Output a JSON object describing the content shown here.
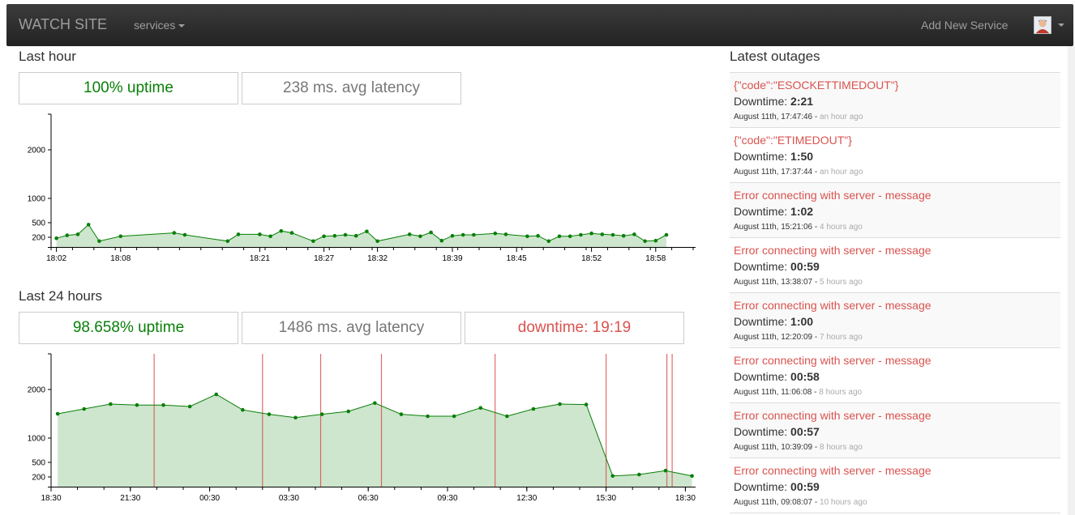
{
  "navbar": {
    "brand": "WATCH SITE",
    "services_label": "services",
    "add_service_label": "Add New Service",
    "avatar_icon": "user-avatar"
  },
  "last_hour": {
    "title": "Last hour",
    "uptime": "100% uptime",
    "latency": "238 ms. avg latency"
  },
  "last_24": {
    "title": "Last 24 hours",
    "uptime": "98.658% uptime",
    "latency": "1486 ms. avg latency",
    "downtime": "downtime: 19:19"
  },
  "colors": {
    "green": "#087f08",
    "red": "#d9534f",
    "area": "#cde6cd"
  },
  "chart_data": [
    {
      "type": "area",
      "name": "last_hour",
      "ylim": [
        0,
        2700
      ],
      "yticks": [
        200,
        500,
        1000,
        2000
      ],
      "xlim": [
        0,
        60
      ],
      "xticks": [
        {
          "x": 0.5,
          "label": "18:02"
        },
        {
          "x": 6.5,
          "label": "18:08"
        },
        {
          "x": 19.5,
          "label": "18:21"
        },
        {
          "x": 25.5,
          "label": "18:27"
        },
        {
          "x": 30.5,
          "label": "18:32"
        },
        {
          "x": 37.5,
          "label": "18:39"
        },
        {
          "x": 43.5,
          "label": "18:45"
        },
        {
          "x": 50.5,
          "label": "18:52"
        },
        {
          "x": 56.5,
          "label": "18:58"
        }
      ],
      "x": [
        0.5,
        1.5,
        2.5,
        3.5,
        4.5,
        6.5,
        11.5,
        12.5,
        16.5,
        17.5,
        19.5,
        20.5,
        21.5,
        22.5,
        24.5,
        25.5,
        26.5,
        27.5,
        28.5,
        29.5,
        30.5,
        33.5,
        34.5,
        35.5,
        36.5,
        37.5,
        38.5,
        39.5,
        41.5,
        42.5,
        44.5,
        45.5,
        46.5,
        47.5,
        48.5,
        49.5,
        50.5,
        51.5,
        52.5,
        53.5,
        54.5,
        55.5,
        56.5,
        57.5
      ],
      "values": [
        180,
        240,
        260,
        460,
        120,
        220,
        290,
        250,
        120,
        260,
        260,
        220,
        330,
        290,
        120,
        220,
        230,
        250,
        230,
        320,
        120,
        260,
        220,
        300,
        130,
        230,
        250,
        250,
        280,
        260,
        220,
        230,
        120,
        220,
        220,
        250,
        280,
        260,
        250,
        230,
        260,
        120,
        130,
        250
      ]
    },
    {
      "type": "area",
      "name": "last_24_hours",
      "ylim": [
        0,
        2700
      ],
      "yticks": [
        200,
        500,
        1000,
        2000
      ],
      "xlim": [
        0,
        24
      ],
      "xticks": [
        {
          "x": 0,
          "label": "18:30"
        },
        {
          "x": 3,
          "label": "21:30"
        },
        {
          "x": 6,
          "label": "00:30"
        },
        {
          "x": 9,
          "label": "03:30"
        },
        {
          "x": 12,
          "label": "06:30"
        },
        {
          "x": 15,
          "label": "09:30"
        },
        {
          "x": 18,
          "label": "12:30"
        },
        {
          "x": 21,
          "label": "15:30"
        },
        {
          "x": 24,
          "label": "18:30"
        }
      ],
      "x": [
        0.25,
        1.25,
        2.25,
        3.25,
        4.25,
        5.25,
        6.25,
        7.25,
        8.25,
        9.25,
        10.25,
        11.25,
        12.25,
        13.25,
        14.25,
        15.25,
        16.25,
        17.25,
        18.25,
        19.25,
        20.25,
        21.25,
        22.25,
        23.25,
        24.25
      ],
      "values": [
        1500,
        1600,
        1700,
        1680,
        1680,
        1650,
        1900,
        1580,
        1490,
        1420,
        1490,
        1550,
        1720,
        1490,
        1450,
        1450,
        1620,
        1450,
        1600,
        1700,
        1690,
        220,
        250,
        330,
        220
      ],
      "outage_marks": [
        3.9,
        8.0,
        10.2,
        12.5,
        16.8,
        21.0,
        23.3,
        23.5
      ]
    }
  ],
  "outages": {
    "title": "Latest outages",
    "downtime_label": "Downtime:",
    "items": [
      {
        "message": "{\"code\":\"ESOCKETTIMEDOUT\"}",
        "downtime": "2:21",
        "date": "August 11th, 17:47:46 -",
        "ago": "an hour ago"
      },
      {
        "message": "{\"code\":\"ETIMEDOUT\"}",
        "downtime": "1:50",
        "date": "August 11th, 17:37:44 -",
        "ago": "an hour ago"
      },
      {
        "message": "Error connecting with server - message",
        "downtime": "1:02",
        "date": "August 11th, 15:21:06 -",
        "ago": "4 hours ago"
      },
      {
        "message": "Error connecting with server - message",
        "downtime": "00:59",
        "date": "August 11th, 13:38:07 -",
        "ago": "5 hours ago"
      },
      {
        "message": "Error connecting with server - message",
        "downtime": "1:00",
        "date": "August 11th, 12:20:09 -",
        "ago": "7 hours ago"
      },
      {
        "message": "Error connecting with server - message",
        "downtime": "00:58",
        "date": "August 11th, 11:06:08 -",
        "ago": "8 hours ago"
      },
      {
        "message": "Error connecting with server - message",
        "downtime": "00:57",
        "date": "August 11th, 10:39:09 -",
        "ago": "8 hours ago"
      },
      {
        "message": "Error connecting with server - message",
        "downtime": "00:59",
        "date": "August 11th, 09:08:07 -",
        "ago": "10 hours ago"
      }
    ]
  }
}
